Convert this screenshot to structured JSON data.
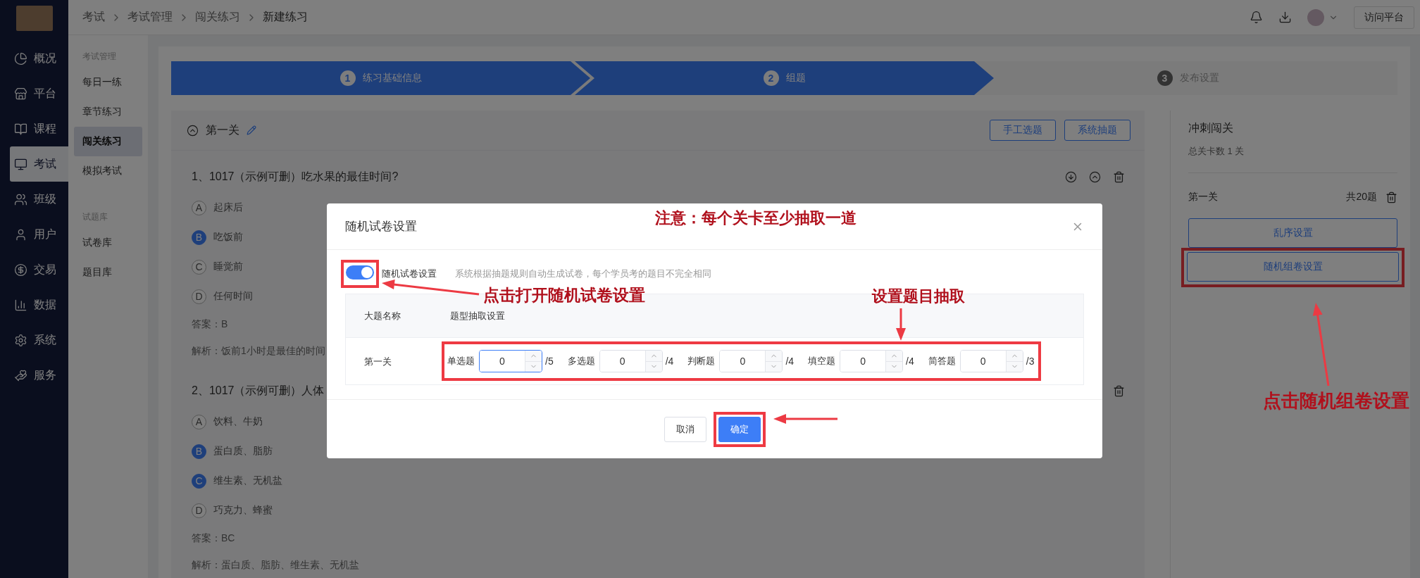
{
  "nav": {
    "items": [
      {
        "label": "概况",
        "selected": false
      },
      {
        "label": "平台",
        "selected": false
      },
      {
        "label": "课程",
        "selected": false
      },
      {
        "label": "考试",
        "selected": true
      },
      {
        "label": "班级",
        "selected": false
      },
      {
        "label": "用户",
        "selected": false
      },
      {
        "label": "交易",
        "selected": false
      },
      {
        "label": "数据",
        "selected": false
      },
      {
        "label": "系统",
        "selected": false
      },
      {
        "label": "服务",
        "selected": false
      }
    ]
  },
  "breadcrumb": [
    "考试",
    "考试管理",
    "闯关练习",
    "新建练习"
  ],
  "header": {
    "visit_button": "访问平台"
  },
  "subnav": {
    "groups": [
      {
        "title": "考试管理",
        "items": [
          {
            "label": "每日一练",
            "selected": false
          },
          {
            "label": "章节练习",
            "selected": false
          },
          {
            "label": "闯关练习",
            "selected": true
          },
          {
            "label": "模拟考试",
            "selected": false
          }
        ]
      },
      {
        "title": "试题库",
        "items": [
          {
            "label": "试卷库",
            "selected": false
          },
          {
            "label": "题目库",
            "selected": false
          }
        ]
      }
    ]
  },
  "steps": [
    {
      "number": "1",
      "label": "练习基础信息",
      "active": true
    },
    {
      "number": "2",
      "label": "组题",
      "active": true
    },
    {
      "number": "3",
      "label": "发布设置",
      "active": false
    }
  ],
  "level_panel": {
    "title": "第一关",
    "buttons": [
      "手工选题",
      "系统抽题"
    ],
    "questions": [
      {
        "title": "1、1017（示例可删）吃水果的最佳时间?",
        "options": [
          {
            "letter": "A",
            "text": "起床后",
            "correct": false
          },
          {
            "letter": "B",
            "text": "吃饭前",
            "correct": true
          },
          {
            "letter": "C",
            "text": "睡觉前",
            "correct": false
          },
          {
            "letter": "D",
            "text": "任何时间",
            "correct": false
          }
        ],
        "answer": "答案：B",
        "analysis": "解析：饭前1小时是最佳的时间",
        "reorder_icons": true
      },
      {
        "title": "2、1017（示例可删）人体",
        "options": [
          {
            "letter": "A",
            "text": "饮料、牛奶",
            "correct": false
          },
          {
            "letter": "B",
            "text": "蛋白质、脂肪",
            "correct": true
          },
          {
            "letter": "C",
            "text": "维生素、无机盐",
            "correct": true
          },
          {
            "letter": "D",
            "text": "巧克力、蜂蜜",
            "correct": false
          }
        ],
        "answer": "答案：BC",
        "analysis": "解析：蛋白质、脂肪、维生素、无机盐",
        "reorder_icons": false
      }
    ]
  },
  "summary_panel": {
    "title": "冲刺闯关",
    "count": "总关卡数 1 关",
    "level_name": "第一关",
    "level_total": "共20题",
    "buttons": [
      "乱序设置",
      "随机组卷设置"
    ]
  },
  "modal": {
    "title": "随机试卷设置",
    "toggle": {
      "on": true,
      "label": "随机试卷设置"
    },
    "hint": "系统根据抽题规则自动生成试卷，每个学员考的题目不完全相同",
    "columns": [
      "大题名称",
      "题型抽取设置"
    ],
    "rows": [
      {
        "name": "第一关",
        "types": [
          {
            "label": "单选题",
            "value": "0",
            "total": "/5",
            "focused": true
          },
          {
            "label": "多选题",
            "value": "0",
            "total": "/4",
            "focused": false
          },
          {
            "label": "判断题",
            "value": "0",
            "total": "/4",
            "focused": false
          },
          {
            "label": "填空题",
            "value": "0",
            "total": "/4",
            "focused": false
          },
          {
            "label": "简答题",
            "value": "0",
            "total": "/3",
            "focused": false
          }
        ]
      }
    ],
    "buttons": [
      {
        "label": "取消",
        "kind": "default"
      },
      {
        "label": "确定",
        "kind": "primary"
      }
    ]
  },
  "annotations": {
    "notice": "注意：每个关卡至少抽取一道",
    "toggle_hint": "点击打开随机试卷设置",
    "inputs_hint": "设置题目抽取",
    "button_hint": "点击随机组卷设置"
  }
}
